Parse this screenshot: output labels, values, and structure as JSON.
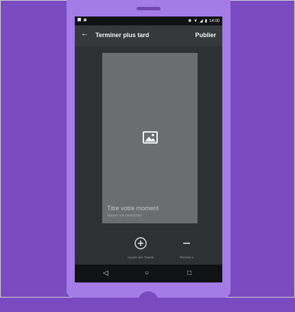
{
  "status_bar": {
    "time": "14:00"
  },
  "toolbar": {
    "back_glyph": "←",
    "title": "Terminer plus tard",
    "publish_label": "Publier"
  },
  "moment_card": {
    "icon": "image-icon",
    "title": "Titre votre moment",
    "subtitle": "Ajouter une description"
  },
  "actions": {
    "add_tweet": {
      "label": "Ajouter des Tweets",
      "glyph": "+"
    },
    "finish": {
      "label": "Terminé·e",
      "glyph": "−"
    }
  },
  "nav_bar": {
    "back_glyph": "◁",
    "home_glyph": "○",
    "recents_glyph": "□"
  },
  "colors": {
    "background": "#7a4bc0",
    "phone": "#a57ce6",
    "screen": "#2e3133",
    "card": "#6b6e70"
  }
}
